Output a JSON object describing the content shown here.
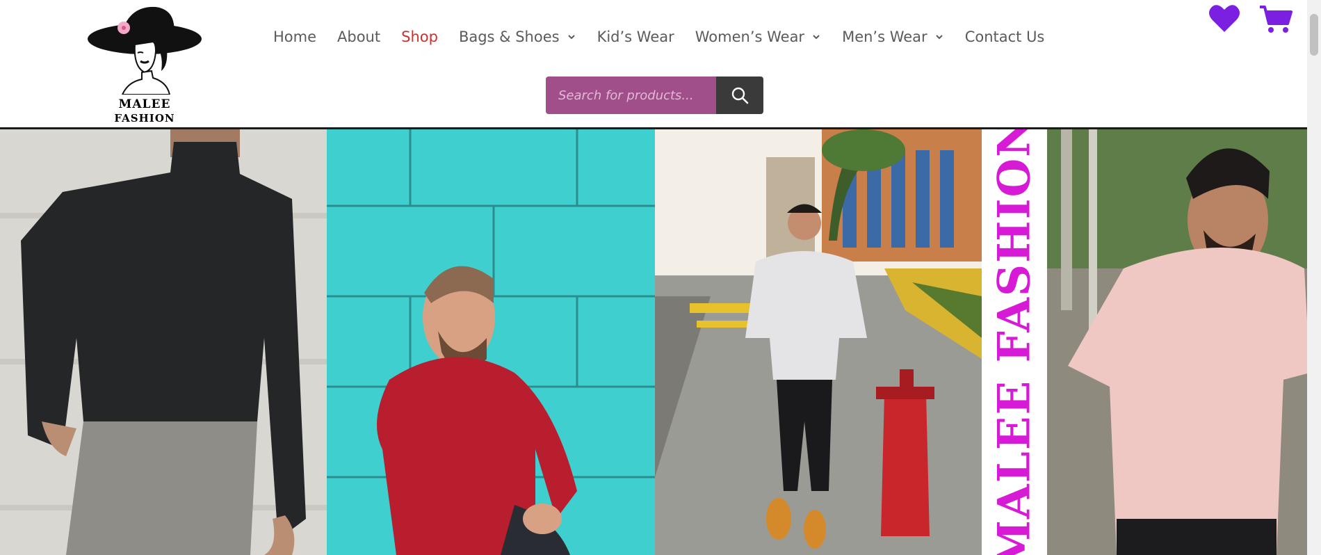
{
  "brand": {
    "name_line1": "MALEE",
    "name_line2": "FASHION"
  },
  "nav": {
    "items": [
      {
        "label": "Home",
        "active": false,
        "dropdown": false
      },
      {
        "label": "About",
        "active": false,
        "dropdown": false
      },
      {
        "label": "Shop",
        "active": true,
        "dropdown": false
      },
      {
        "label": "Bags & Shoes",
        "active": false,
        "dropdown": true
      },
      {
        "label": "Kid’s Wear",
        "active": false,
        "dropdown": false
      },
      {
        "label": "Women’s Wear",
        "active": false,
        "dropdown": true
      },
      {
        "label": "Men’s Wear",
        "active": false,
        "dropdown": true
      },
      {
        "label": "Contact Us",
        "active": false,
        "dropdown": false
      }
    ]
  },
  "search": {
    "placeholder": "Search for products...",
    "button_icon": "search-icon"
  },
  "header_icons": {
    "wishlist_icon": "heart-icon",
    "cart_icon": "cart-icon"
  },
  "banner": {
    "vertical_text": "MALEE FASHION",
    "panels": [
      "model-black-sweater",
      "model-red-sweater-teal-wall",
      "model-street-hydrant",
      "model-pink-tshirt"
    ]
  },
  "colors": {
    "accent_purple": "#7b1fe0",
    "active_nav": "#d32f2f",
    "search_bg": "#a04f8a",
    "search_btn": "#3a3a3a",
    "banner_text": "#d61ad6"
  }
}
